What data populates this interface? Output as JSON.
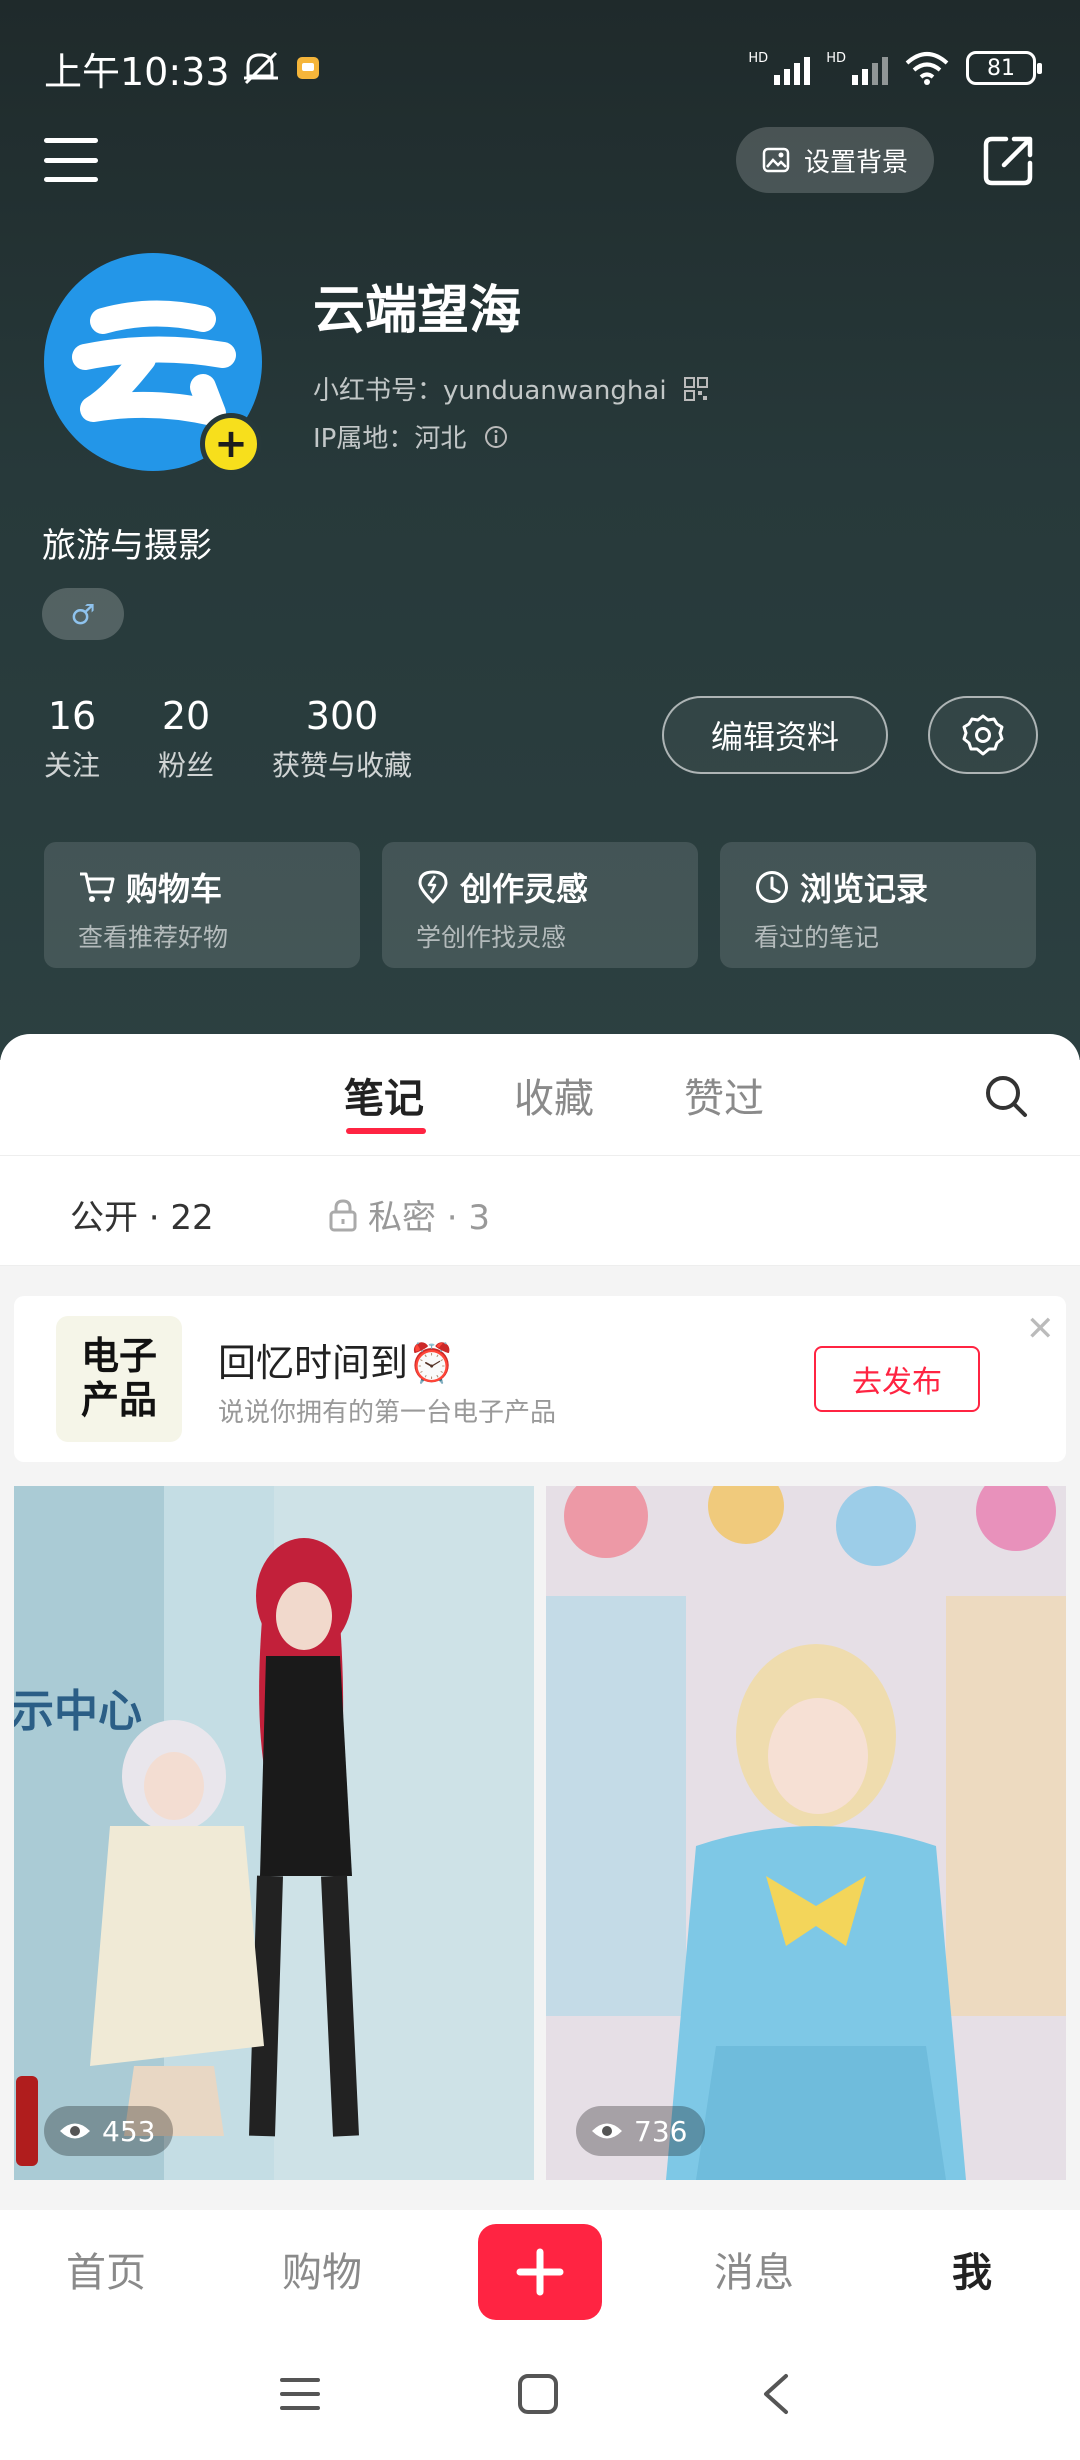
{
  "status_bar": {
    "time": "上午10:33",
    "network_badge_1": "HD",
    "network_badge_2": "HD",
    "battery": "81"
  },
  "top": {
    "set_background_label": "设置背景"
  },
  "profile": {
    "avatar_text": "云",
    "name": "云端望海",
    "id_label": "小红书号：yunduanwanghai",
    "ip_label": "IP属地：河北",
    "bio": "旅游与摄影",
    "gender_symbol": "♂"
  },
  "stats": [
    {
      "num": "16",
      "label": "关注"
    },
    {
      "num": "20",
      "label": "粉丝"
    },
    {
      "num": "300",
      "label": "获赞与收藏"
    }
  ],
  "edit_profile_label": "编辑资料",
  "shortcut_cards": [
    {
      "title": "购物车",
      "sub": "查看推荐好物",
      "icon": "cart-icon"
    },
    {
      "title": "创作灵感",
      "sub": "学创作找灵感",
      "icon": "lightbulb-icon"
    },
    {
      "title": "浏览记录",
      "sub": "看过的笔记",
      "icon": "clock-icon"
    }
  ],
  "tabs": [
    "笔记",
    "收藏",
    "赞过"
  ],
  "subtabs": {
    "public": "公开 · 22",
    "private": "私密 · 3"
  },
  "banner": {
    "thumb_text": "电子\n产品",
    "title": "回忆时间到⏰",
    "subtitle": "说说你拥有的第一台电子产品",
    "button": "去发布"
  },
  "notes": [
    {
      "views": "453"
    },
    {
      "views": "736"
    }
  ],
  "bottom_nav": [
    "首页",
    "购物",
    "消息",
    "我"
  ],
  "colors": {
    "brand_red": "#ff2442",
    "avatar_blue": "#2396e8",
    "header_dark": "#27393a"
  }
}
